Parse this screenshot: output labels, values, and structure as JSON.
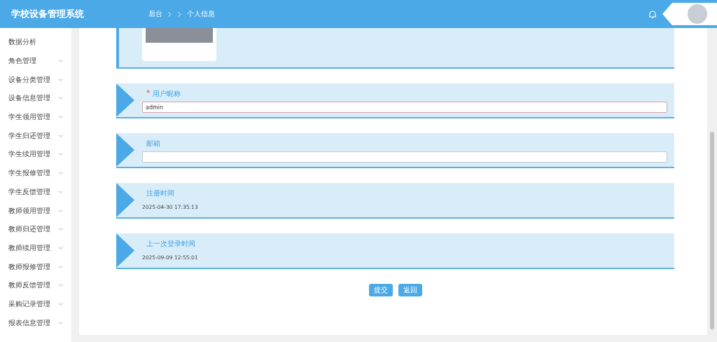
{
  "header": {
    "title": "学校设备管理系统",
    "breadcrumb": [
      "后台",
      "个人信息"
    ]
  },
  "sidebar": {
    "items": [
      {
        "label": "数据分析",
        "kind": "link"
      },
      {
        "label": "角色管理",
        "kind": "submenu"
      },
      {
        "label": "设备分类管理",
        "kind": "submenu"
      },
      {
        "label": "设备信息管理",
        "kind": "submenu"
      },
      {
        "label": "学生领用管理",
        "kind": "submenu"
      },
      {
        "label": "学生归还管理",
        "kind": "submenu"
      },
      {
        "label": "学生续用管理",
        "kind": "submenu"
      },
      {
        "label": "学生报修管理",
        "kind": "submenu"
      },
      {
        "label": "学生反馈管理",
        "kind": "submenu"
      },
      {
        "label": "教师领用管理",
        "kind": "submenu"
      },
      {
        "label": "教师归还管理",
        "kind": "submenu"
      },
      {
        "label": "教师续用管理",
        "kind": "submenu"
      },
      {
        "label": "教师报修管理",
        "kind": "submenu"
      },
      {
        "label": "教师反馈管理",
        "kind": "submenu"
      },
      {
        "label": "采购记录管理",
        "kind": "submenu"
      },
      {
        "label": "报表信息管理",
        "kind": "submenu"
      }
    ]
  },
  "form": {
    "sections": [
      {
        "kind": "avatar"
      },
      {
        "kind": "input",
        "label": "用户昵称",
        "required": true,
        "required_mark": "*",
        "value": "admin"
      },
      {
        "kind": "input",
        "label": "邮箱",
        "required": false
      },
      {
        "kind": "text",
        "label": "注册时间",
        "value": "2025-04-30 17:35:13"
      },
      {
        "kind": "text",
        "label": "上一次登录时间",
        "value": "2025-09-09 12:55:01"
      }
    ],
    "buttons": [
      "提交",
      "返回"
    ]
  }
}
